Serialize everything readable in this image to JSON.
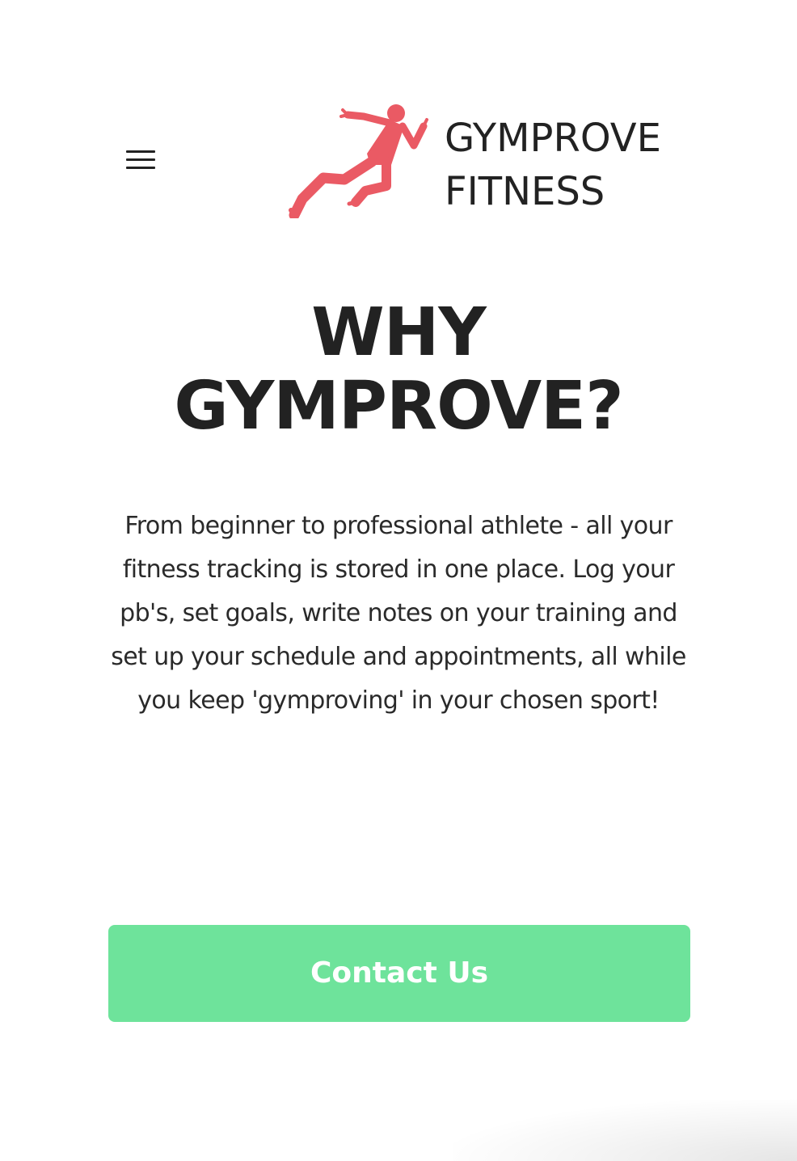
{
  "header": {
    "menu_icon": "hamburger-menu-icon",
    "logo_icon": "sprinter-runner-logo",
    "brand_line1": "GYMPROVE",
    "brand_line2": "FITNESS"
  },
  "hero": {
    "title_line1": "WHY",
    "title_line2": "GYMPROVE?",
    "body": "From beginner to professional athlete - all your fitness tracking is stored in one place. Log your pb's, set goals, write notes on your training and set up your schedule and appointments, all while you keep 'gymproving' in your chosen sport!"
  },
  "contact_button": {
    "label": "Contact Us"
  },
  "colors": {
    "logo": "#ea5a64",
    "button": "#6ee39b",
    "text": "#222222",
    "button_text": "#ffffff"
  }
}
